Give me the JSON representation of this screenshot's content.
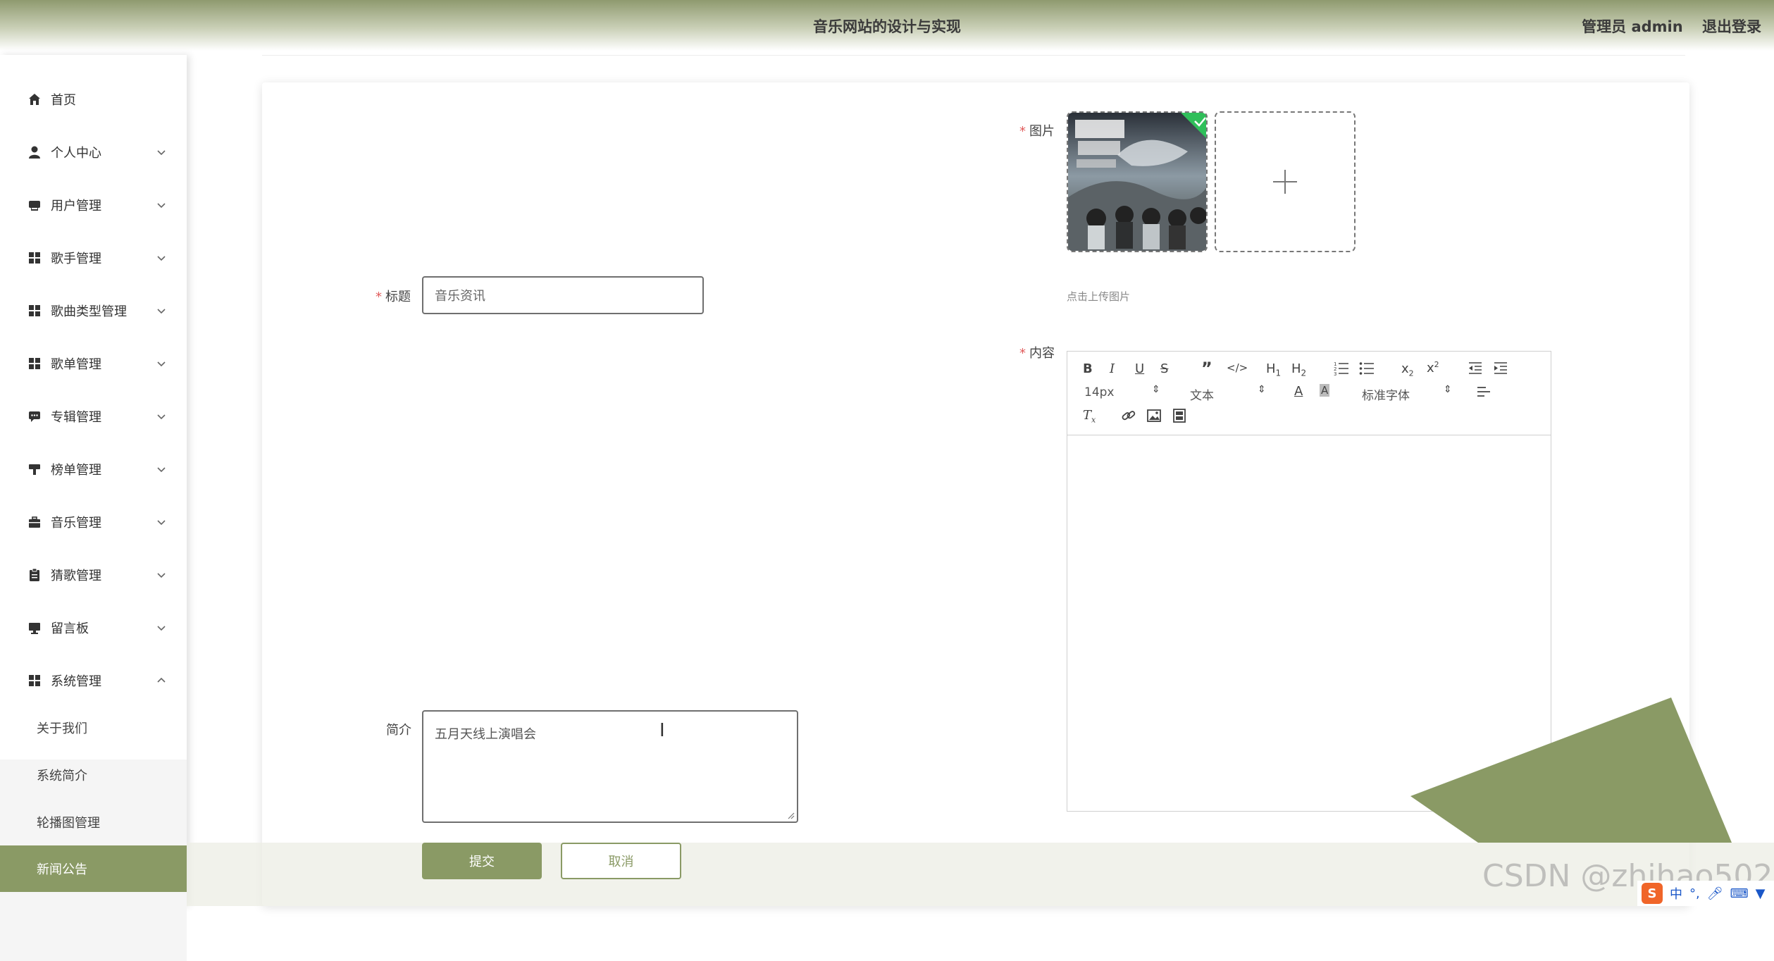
{
  "header": {
    "title": "音乐网站的设计与实现",
    "user_label": "管理员 admin",
    "logout_label": "退出登录"
  },
  "sidebar": {
    "items": [
      {
        "label": "首页",
        "icon": "home-icon"
      },
      {
        "label": "个人中心",
        "icon": "user-icon"
      },
      {
        "label": "用户管理",
        "icon": "printer-icon"
      },
      {
        "label": "歌手管理",
        "icon": "grid-icon"
      },
      {
        "label": "歌曲类型管理",
        "icon": "grid-icon"
      },
      {
        "label": "歌单管理",
        "icon": "grid-icon"
      },
      {
        "label": "专辑管理",
        "icon": "message-icon"
      },
      {
        "label": "榜单管理",
        "icon": "hammer-icon"
      },
      {
        "label": "音乐管理",
        "icon": "briefcase-icon"
      },
      {
        "label": "猜歌管理",
        "icon": "clipboard-icon"
      },
      {
        "label": "留言板",
        "icon": "monitor-icon"
      },
      {
        "label": "系统管理",
        "icon": "grid-icon"
      }
    ],
    "submenu": [
      {
        "label": "关于我们"
      },
      {
        "label": "系统简介"
      },
      {
        "label": "轮播图管理"
      },
      {
        "label": "新闻公告"
      }
    ]
  },
  "form": {
    "title_label": "标题",
    "title_placeholder": "音乐资讯",
    "image_label": "图片",
    "upload_tip": "点击上传图片",
    "content_label": "内容",
    "intro_label": "简介",
    "intro_value": "五月天线上演唱会",
    "submit_label": "提交",
    "cancel_label": "取消"
  },
  "editor": {
    "font_size": "14px",
    "header_select": "文本",
    "font_family": "标准字体"
  },
  "watermark": "CSDN @zhihao502",
  "ime": {
    "text": "中"
  },
  "colors": {
    "accent": "#8a9a65",
    "required": "#e05a5a",
    "header_top": "#8f9a6f"
  }
}
